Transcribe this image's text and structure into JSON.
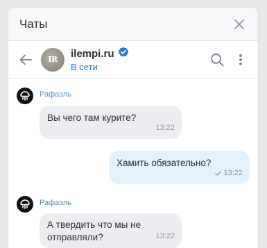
{
  "panel": {
    "title": "Чаты"
  },
  "chat": {
    "name": "ilempi.ru",
    "status": "В сети",
    "avatar_initials": "IR",
    "verified": true
  },
  "icons": {
    "close": "close-icon",
    "back": "arrow-left-icon",
    "verified": "verified-badge-icon",
    "search": "search-icon",
    "more": "more-vertical-icon",
    "read": "check-icon"
  },
  "messages": [
    {
      "direction": "in",
      "sender": "Рафаэль",
      "lines": [
        "Вы чего там курите?"
      ],
      "time": "13:22"
    },
    {
      "direction": "out",
      "lines": [
        "Хамить обязательно?"
      ],
      "time": "13:22",
      "read": true
    },
    {
      "direction": "in",
      "sender": "Рафаэль",
      "lines": [
        "А твердить что мы не",
        "отправляли?"
      ],
      "time": "13:22"
    }
  ],
  "colors": {
    "accent": "#2a77c9",
    "verified": "#2a77c9",
    "incoming_bubble": "#ecedf1",
    "outgoing_bubble": "#e3f2fc",
    "sender_name": "#5d8bbf"
  }
}
